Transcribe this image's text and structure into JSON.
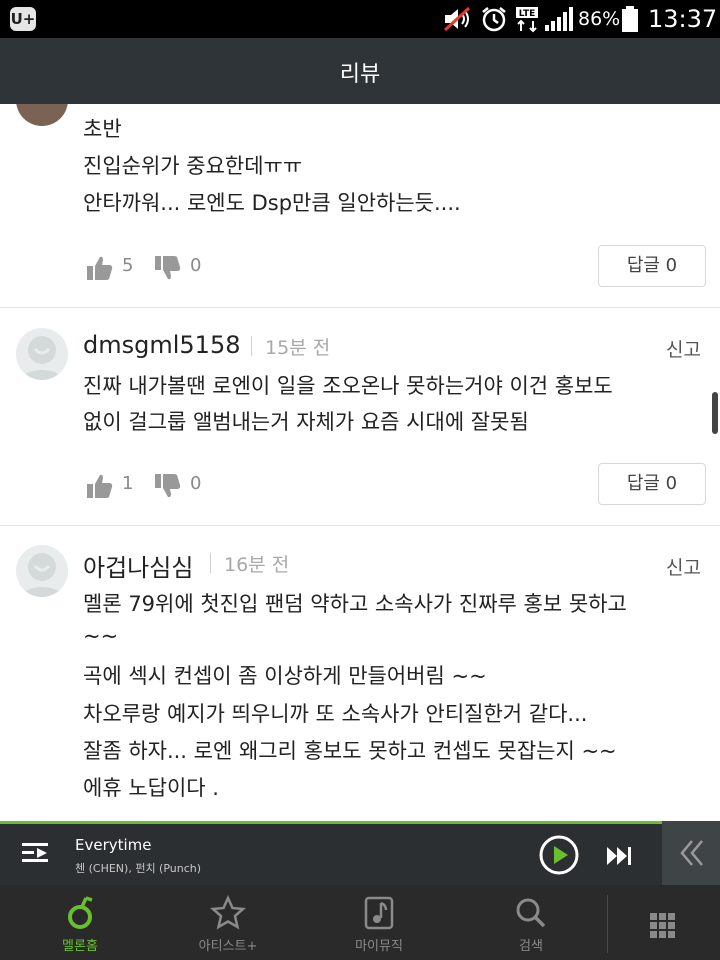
{
  "status_bar": {
    "carrier_logo": "U+",
    "battery": "86%",
    "time": "13:37",
    "icons": [
      "mute-icon",
      "alarm-icon",
      "lte-icon",
      "signal-icon",
      "battery-icon"
    ]
  },
  "header": {
    "title": "리뷰"
  },
  "comments": [
    {
      "text_lines": [
        "초반",
        "진입순위가 중요한데ㅠㅠ",
        "안타까워... 로엔도 Dsp만큼 일안하는듯...."
      ],
      "likes": "5",
      "dislikes": "0",
      "reply_label": "답글 0"
    },
    {
      "username": "dmsgml5158",
      "time": "15분 전",
      "report": "신고",
      "text_lines": [
        "진짜 내가볼땐 로엔이 일을 조오온나 못하는거야 이건 홍보도",
        "없이 걸그룹 앨범내는거 자체가 요즘 시대에 잘못됨"
      ],
      "likes": "1",
      "dislikes": "0",
      "reply_label": "답글 0"
    },
    {
      "username": "아겁나심심",
      "time": "16분 전",
      "report": "신고",
      "text_lines": [
        "멜론 79위에 첫진입 팬덤 약하고 소속사가 진짜루 홍보 못하고",
        "~~",
        "곡에 섹시 컨셉이 좀 이상하게 만들어버림 ~~",
        "차오루랑 예지가 띄우니까 또 소속사가 안티질한거 같다...",
        "잘좀 하자... 로엔 왜그리 홍보도 못하고 컨셉도 못잡는지 ~~",
        "에휴 노답이다 ."
      ]
    }
  ],
  "player": {
    "song": "Everytime",
    "artist": "첸 (CHEN), 펀치 (Punch)"
  },
  "nav": [
    {
      "label": "멜론홈",
      "icon": "melon-home-icon",
      "active": true
    },
    {
      "label": "아티스트+",
      "icon": "star-icon",
      "active": false
    },
    {
      "label": "마이뮤직",
      "icon": "music-note-icon",
      "active": false
    },
    {
      "label": "검색",
      "icon": "search-icon",
      "active": false
    },
    {
      "label": "",
      "icon": "grid-menu-icon",
      "active": false
    }
  ],
  "colors": {
    "accent": "#6abf2e",
    "header_bg": "#2f3438",
    "player_bg": "#2b2f31",
    "nav_bg": "#2a2a2a"
  }
}
